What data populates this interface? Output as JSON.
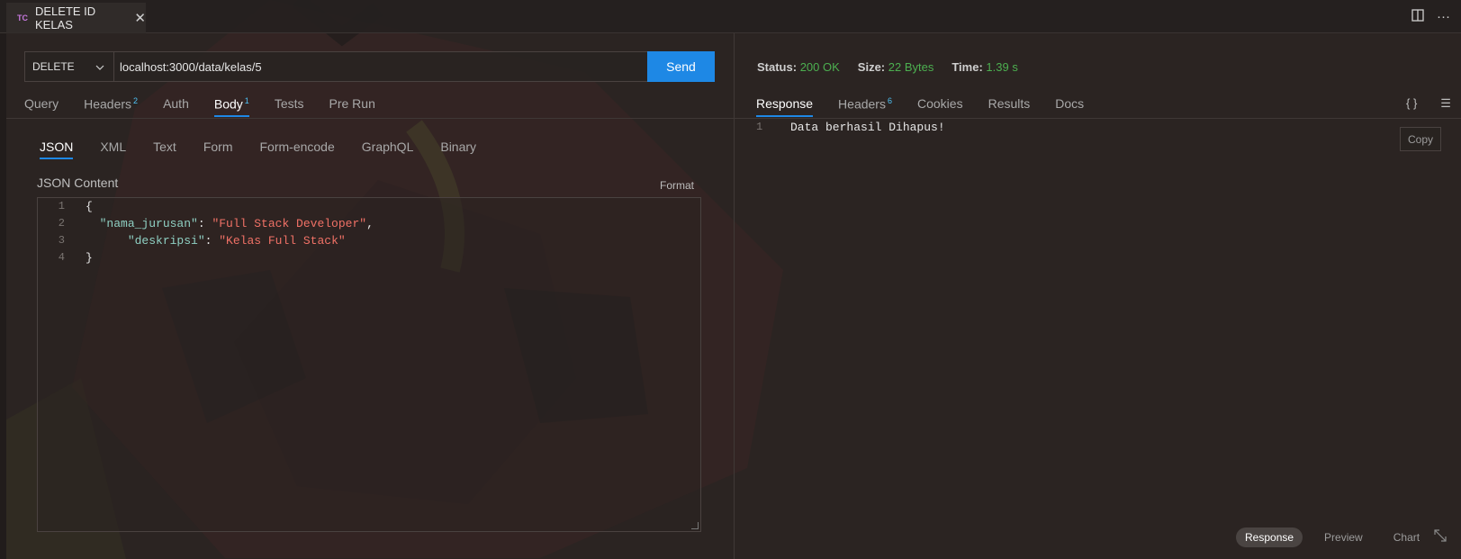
{
  "tab": {
    "badge": "TC",
    "title": "DELETE ID KELAS",
    "close": "✕"
  },
  "top_actions": {
    "split_icon": "split-editor-icon",
    "more": "···"
  },
  "request": {
    "method": "DELETE",
    "url": "localhost:3000/data/kelas/5",
    "send_label": "Send"
  },
  "request_tabs": [
    {
      "label": "Query",
      "badge": ""
    },
    {
      "label": "Headers",
      "badge": "2"
    },
    {
      "label": "Auth",
      "badge": ""
    },
    {
      "label": "Body",
      "badge": "1",
      "active": true
    },
    {
      "label": "Tests",
      "badge": ""
    },
    {
      "label": "Pre Run",
      "badge": ""
    }
  ],
  "body_tabs": [
    "JSON",
    "XML",
    "Text",
    "Form",
    "Form-encode",
    "GraphQL",
    "Binary"
  ],
  "json_content_label": "JSON Content",
  "format_label": "Format",
  "editor": {
    "line_numbers": [
      "1",
      "2",
      "3",
      "4"
    ],
    "line1": "{",
    "line2_key": "\"nama_jurusan\"",
    "line2_colon": ": ",
    "line2_val": "\"Full Stack Developer\"",
    "line2_comma": ",",
    "line3_key": "\"deskripsi\"",
    "line3_colon": ": ",
    "line3_val": "\"Kelas Full Stack\"",
    "line4": "}"
  },
  "status": {
    "status_label": "Status:",
    "status_value": "200 OK",
    "size_label": "Size:",
    "size_value": "22 Bytes",
    "time_label": "Time:",
    "time_value": "1.39 s"
  },
  "response_tabs": [
    {
      "label": "Response",
      "badge": "",
      "active": true
    },
    {
      "label": "Headers",
      "badge": "6"
    },
    {
      "label": "Cookies",
      "badge": ""
    },
    {
      "label": "Results",
      "badge": ""
    },
    {
      "label": "Docs",
      "badge": ""
    }
  ],
  "response_icons": {
    "braces": "{ }",
    "wrap": "☰"
  },
  "response_body": {
    "line_number": "1",
    "text": "Data berhasil Dihapus!"
  },
  "copy_label": "Copy",
  "bottom_tabs": [
    "Response",
    "Preview",
    "Chart"
  ],
  "colors": {
    "accent": "#1e88e5",
    "success": "#4caf50",
    "string": "#f07166",
    "key": "#8fd0c3"
  }
}
